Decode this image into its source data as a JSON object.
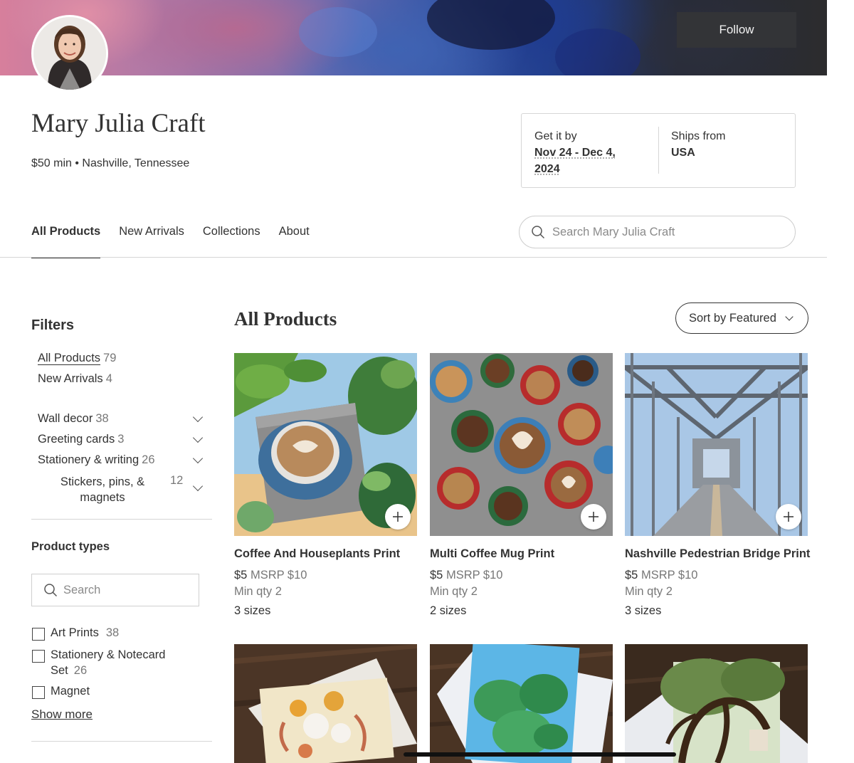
{
  "header": {
    "follow_label": "Follow"
  },
  "shop": {
    "name": "Mary Julia Craft",
    "meta": "$50 min • Nashville, Tennessee"
  },
  "shipping": {
    "get_it_by_label": "Get it by",
    "get_it_by_date_line1": "Nov 24 - Dec 4,",
    "get_it_by_date_line2": "2024",
    "ships_from_label": "Ships from",
    "ships_from_value": "USA"
  },
  "tabs": [
    {
      "label": "All Products",
      "active": true
    },
    {
      "label": "New Arrivals",
      "active": false
    },
    {
      "label": "Collections",
      "active": false
    },
    {
      "label": "About",
      "active": false
    }
  ],
  "search": {
    "placeholder": "Search Mary Julia Craft"
  },
  "filters": {
    "title": "Filters",
    "quick": [
      {
        "label": "All Products",
        "count": "79"
      },
      {
        "label": "New Arrivals",
        "count": "4"
      }
    ],
    "categories": [
      {
        "label": "Wall decor",
        "count": "38"
      },
      {
        "label": "Greeting cards",
        "count": "3"
      },
      {
        "label": "Stationery & writing",
        "count": "26"
      },
      {
        "label_line1": "Stickers, pins, &",
        "label_line2": "magnets",
        "count": "12"
      }
    ],
    "product_types_title": "Product types",
    "product_types_search_placeholder": "Search",
    "product_types": [
      {
        "label": "Art Prints",
        "count": "38"
      },
      {
        "label_line1": "Stationery & Notecard",
        "label_line2": "Set",
        "count": "26"
      },
      {
        "label": "Magnet",
        "count": ""
      }
    ],
    "show_more": "Show more"
  },
  "main": {
    "title": "All Products",
    "sort_label": "Sort by Featured"
  },
  "products": [
    {
      "title": "Coffee And Houseplants Print",
      "price": "$5",
      "msrp": "MSRP $10",
      "min_qty": "Min qty 2",
      "sizes": "3 sizes"
    },
    {
      "title": "Multi Coffee Mug Print",
      "price": "$5",
      "msrp": "MSRP $10",
      "min_qty": "Min qty 2",
      "sizes": "2 sizes"
    },
    {
      "title": "Nashville Pedestrian Bridge Print",
      "price": "$5",
      "msrp": "MSRP $10",
      "min_qty": "Min qty 2",
      "sizes": "3 sizes"
    }
  ],
  "icons": [
    "search-icon",
    "chevron-down-icon",
    "plus-icon"
  ],
  "colors": {
    "text": "#333333",
    "muted": "#777777",
    "border": "#d6d6d6",
    "follow_bg": "#333437"
  }
}
